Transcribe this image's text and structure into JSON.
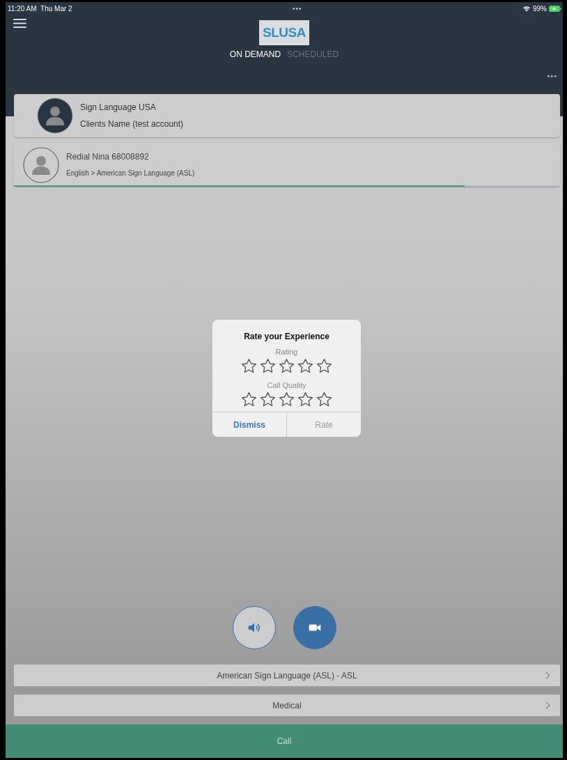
{
  "status_bar": {
    "time": "11:20 AM",
    "date": "Thu Mar 2",
    "dots": "•••",
    "battery": "99%"
  },
  "header": {
    "logo": "SLUSA",
    "tabs": [
      {
        "label": "ON DEMAND",
        "selected": true
      },
      {
        "label": "SCHEDULED",
        "selected": false
      }
    ],
    "more": "•••"
  },
  "account": {
    "name": "Sign Language USA",
    "client": "Clients Name (test account)"
  },
  "redial": {
    "title": "Redial Nina 68008892",
    "languages": "English > American Sign Language (ASL)",
    "level": 0.825
  },
  "dialog": {
    "title": "Rate your Experience",
    "ratings": [
      {
        "label": "Rating",
        "stars": 0
      },
      {
        "label": "Call Quality",
        "stars": 0
      }
    ],
    "buttons": [
      {
        "label": "Dismiss",
        "kind": "primary"
      },
      {
        "label": "Rate",
        "kind": "secondary"
      }
    ]
  },
  "call_modes": [
    {
      "kind": "audio",
      "selected": false
    },
    {
      "kind": "video",
      "selected": true
    }
  ],
  "selectors": [
    {
      "label": "American Sign Language (ASL) - ASL"
    },
    {
      "label": "Medical"
    }
  ],
  "call_button": "Call"
}
